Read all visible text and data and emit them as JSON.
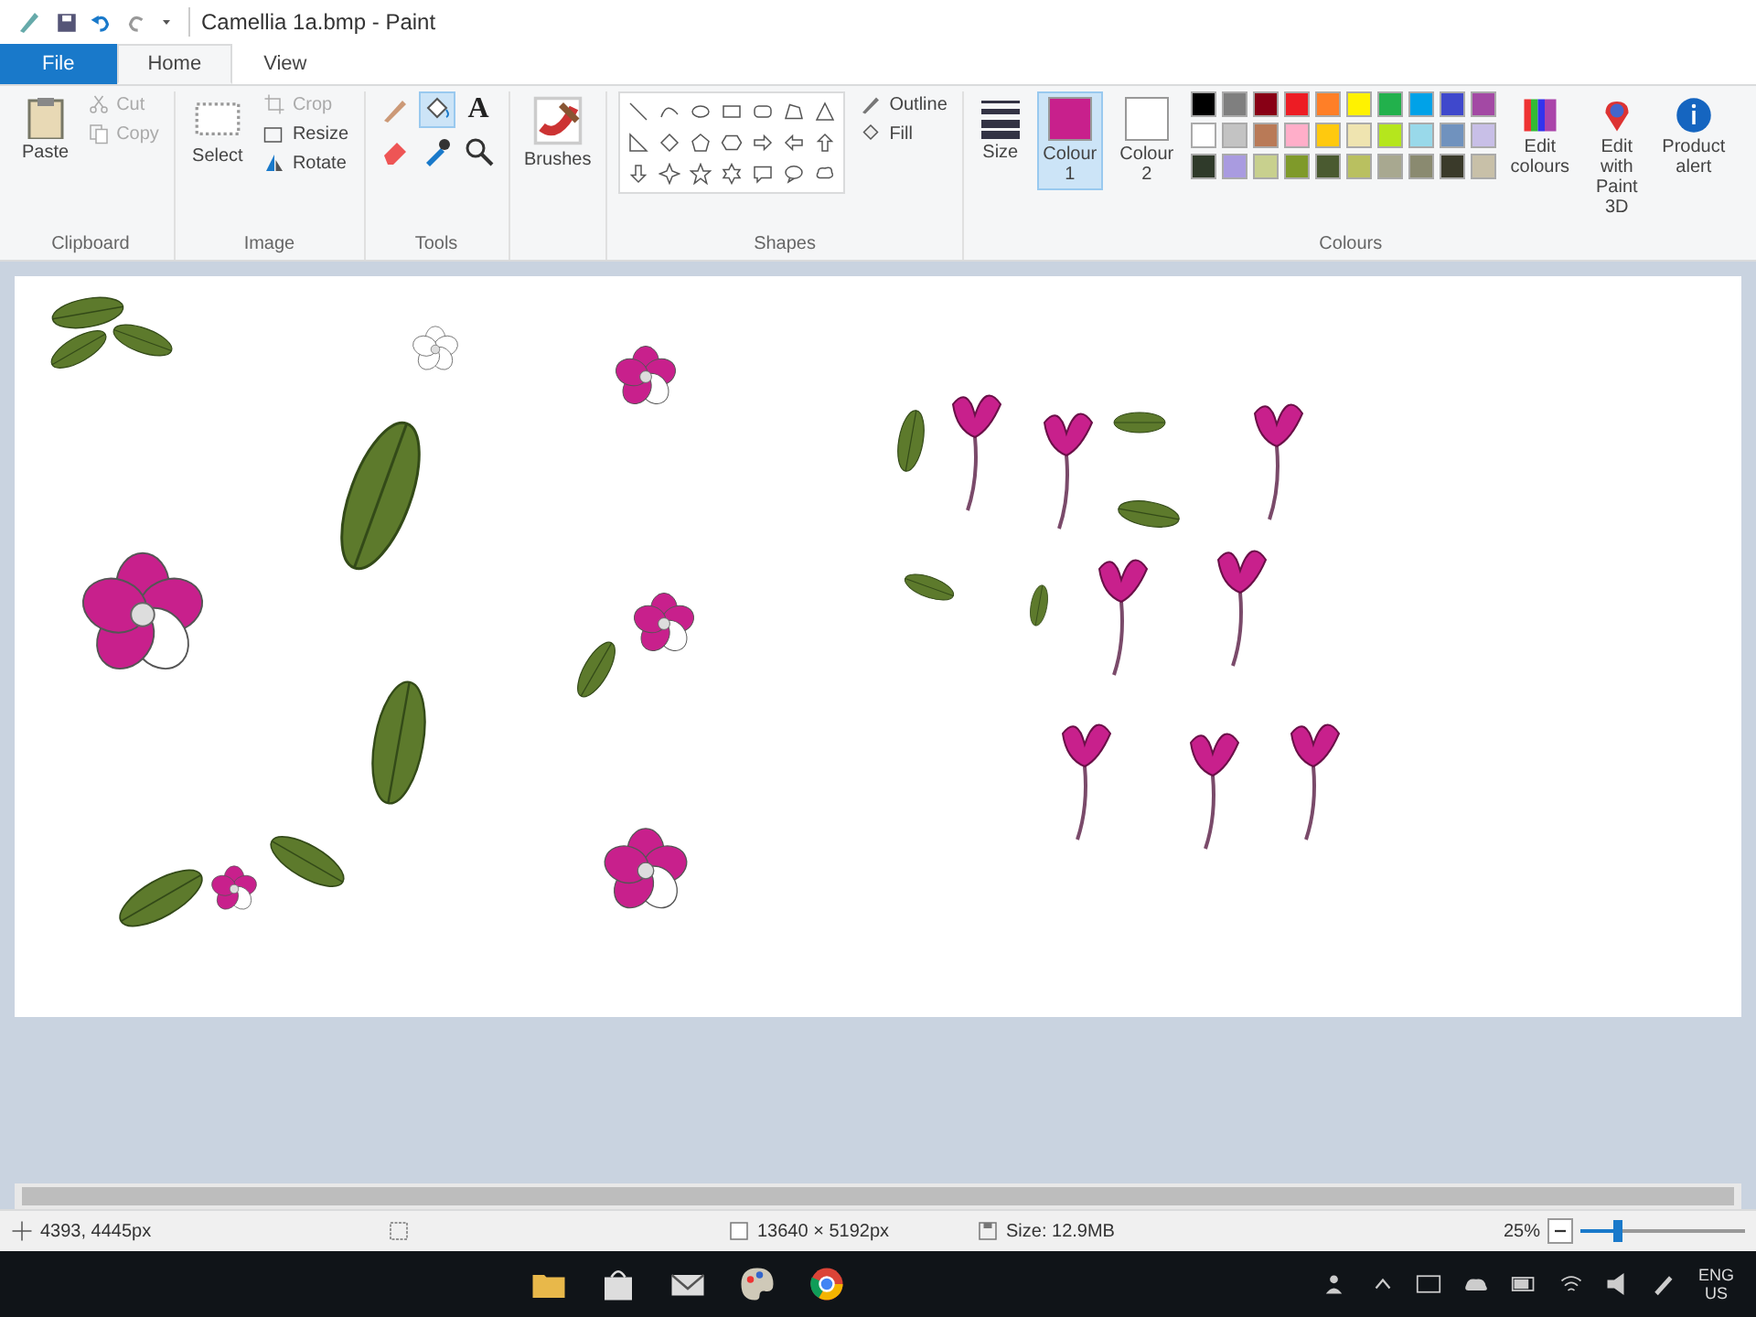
{
  "window": {
    "title": "Camellia 1a.bmp - Paint"
  },
  "tabs": [
    {
      "label": "File",
      "kind": "file",
      "selected": false
    },
    {
      "label": "Home",
      "kind": "tab",
      "selected": true
    },
    {
      "label": "View",
      "kind": "tab",
      "selected": false
    }
  ],
  "ribbon": {
    "clipboard": {
      "paste": "Paste",
      "cut": "Cut",
      "copy": "Copy",
      "label": "Clipboard"
    },
    "image": {
      "select": "Select",
      "crop": "Crop",
      "resize": "Resize",
      "rotate": "Rotate",
      "label": "Image"
    },
    "tools": {
      "text_tool": "A",
      "label": "Tools"
    },
    "brushes": {
      "label": "Brushes"
    },
    "shapes": {
      "outline": "Outline",
      "fill": "Fill",
      "label": "Shapes"
    },
    "size": {
      "label": "Size"
    },
    "colours": {
      "colour_1": {
        "label": "Colour 1",
        "color": "#c8208c",
        "selected": true
      },
      "colour_2": {
        "label": "Colour 2",
        "color": "#ffffff",
        "selected": false
      },
      "palette": [
        {
          "color": "#000000"
        },
        {
          "color": "#7f7f7f"
        },
        {
          "color": "#880015"
        },
        {
          "color": "#ed1c24"
        },
        {
          "color": "#ff7f27"
        },
        {
          "color": "#fff200"
        },
        {
          "color": "#22b14c"
        },
        {
          "color": "#00a2e8"
        },
        {
          "color": "#3f48cc"
        },
        {
          "color": "#a349a4"
        },
        {
          "color": "#ffffff"
        },
        {
          "color": "#c3c3c3"
        },
        {
          "color": "#b97a57"
        },
        {
          "color": "#ffaec9"
        },
        {
          "color": "#ffc90e"
        },
        {
          "color": "#efe4b0"
        },
        {
          "color": "#b5e61d"
        },
        {
          "color": "#99d9ea"
        },
        {
          "color": "#7092be"
        },
        {
          "color": "#c8bfe7"
        },
        {
          "color": "#2f3a2a"
        },
        {
          "color": "#a99be0"
        },
        {
          "color": "#c8d08e"
        },
        {
          "color": "#7f9a2a"
        },
        {
          "color": "#4a5a30"
        },
        {
          "color": "#b9c060"
        },
        {
          "color": "#a8a890"
        },
        {
          "color": "#8a8a70"
        },
        {
          "color": "#3a3a2a"
        },
        {
          "color": "#c8c0a8"
        }
      ],
      "edit_colours": "Edit colours",
      "label": "Colours"
    },
    "paint3d": "Edit with Paint 3D",
    "product_alert": "Product alert"
  },
  "status_bar": {
    "cursor": "4393, 4445px",
    "dimensions": "13640 × 5192px",
    "size": "Size: 12.9MB",
    "zoom": "25%",
    "zoom_slider": {
      "level": 0.2
    }
  },
  "taskbar": {
    "language": "ENG",
    "region": "US"
  }
}
